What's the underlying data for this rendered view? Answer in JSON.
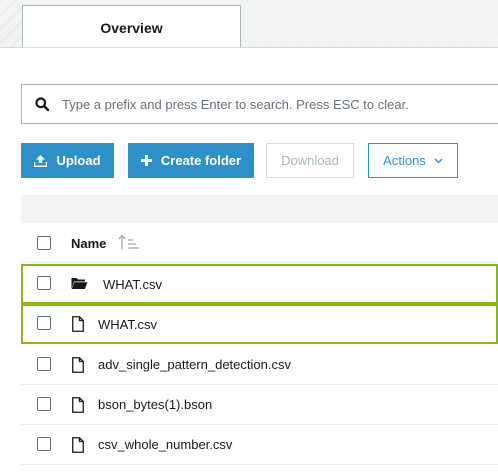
{
  "tabs": [
    {
      "label": "Overview",
      "active": true
    }
  ],
  "search": {
    "placeholder": "Type a prefix and press Enter to search. Press ESC to clear.",
    "value": ""
  },
  "toolbar": {
    "upload_label": "Upload",
    "create_folder_label": "Create folder",
    "download_label": "Download",
    "actions_label": "Actions"
  },
  "table": {
    "columns": [
      {
        "label": "Name",
        "sortable": true
      }
    ],
    "rows": [
      {
        "type": "folder",
        "name": "WHAT.csv",
        "highlighted": true
      },
      {
        "type": "file",
        "name": "WHAT.csv",
        "highlighted": true
      },
      {
        "type": "file",
        "name": "adv_single_pattern_detection.csv",
        "highlighted": false
      },
      {
        "type": "file",
        "name": "bson_bytes(1).bson",
        "highlighted": false
      },
      {
        "type": "file",
        "name": "csv_whole_number.csv",
        "highlighted": false
      }
    ]
  },
  "colors": {
    "primary": "#2f8fc8",
    "highlight_border": "#8db51e",
    "disabled_text": "#aab7b8"
  },
  "icons": {
    "search": "search-icon",
    "upload": "upload-icon",
    "create_folder": "plus-icon",
    "actions_caret": "chevron-down-icon",
    "sort": "sort-ascending-icon",
    "folder": "folder-open-icon",
    "file": "file-icon"
  }
}
